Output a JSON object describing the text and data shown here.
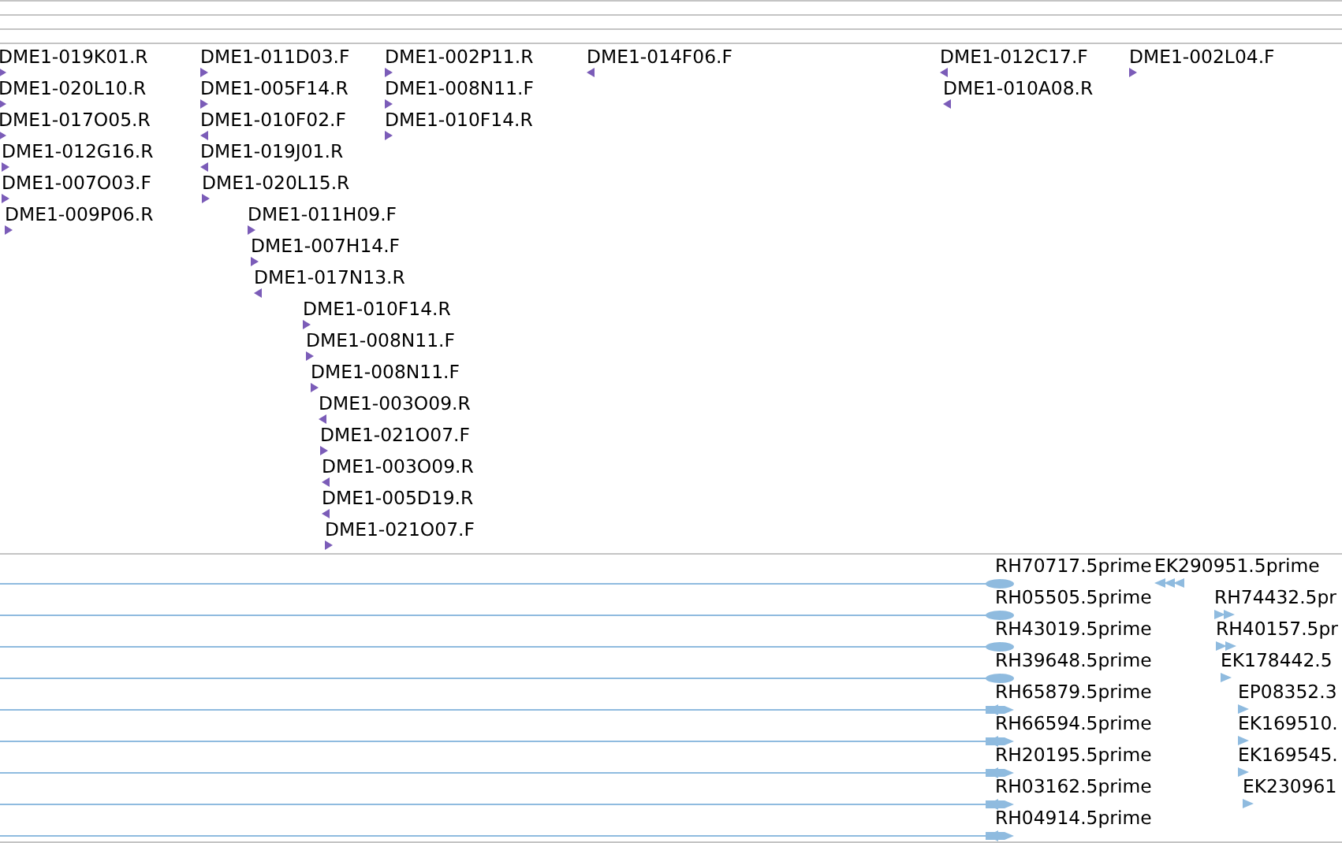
{
  "clone_track": {
    "features": [
      {
        "label": "DME1-019K01.R",
        "reverse": false
      },
      {
        "label": "DME1-011D03.F",
        "reverse": false
      },
      {
        "label": "DME1-002P11.R",
        "reverse": false
      },
      {
        "label": "DME1-014F06.F",
        "reverse": true
      },
      {
        "label": "DME1-012C17.F",
        "reverse": true
      },
      {
        "label": "DME1-002L04.F",
        "reverse": false
      },
      {
        "label": "DME1-020L10.R",
        "reverse": false
      },
      {
        "label": "DME1-005F14.R",
        "reverse": false
      },
      {
        "label": "DME1-008N11.F",
        "reverse": false
      },
      {
        "label": "DME1-010A08.R",
        "reverse": true
      },
      {
        "label": "DME1-017O05.R",
        "reverse": false
      },
      {
        "label": "DME1-010F02.F",
        "reverse": true
      },
      {
        "label": "DME1-010F14.R",
        "reverse": false
      },
      {
        "label": "DME1-012G16.R",
        "reverse": false
      },
      {
        "label": "DME1-019J01.R",
        "reverse": true
      },
      {
        "label": "DME1-007O03.F",
        "reverse": false
      },
      {
        "label": "DME1-020L15.R",
        "reverse": false
      },
      {
        "label": "DME1-009P06.R",
        "reverse": false
      },
      {
        "label": "DME1-011H09.F",
        "reverse": false
      },
      {
        "label": "DME1-007H14.F",
        "reverse": false
      },
      {
        "label": "DME1-017N13.R",
        "reverse": true
      },
      {
        "label": "DME1-010F14.R",
        "reverse": false
      },
      {
        "label": "DME1-008N11.F",
        "reverse": false
      },
      {
        "label": "DME1-008N11.F",
        "reverse": false
      },
      {
        "label": "DME1-003O09.R",
        "reverse": true
      },
      {
        "label": "DME1-021O07.F",
        "reverse": false
      },
      {
        "label": "DME1-003O09.R",
        "reverse": true
      },
      {
        "label": "DME1-005D19.R",
        "reverse": true
      },
      {
        "label": "DME1-021O07.F",
        "reverse": false
      }
    ]
  },
  "est_track": {
    "features": [
      {
        "label": "RH70717.5prime",
        "kind": "oval"
      },
      {
        "label": "EK290951.5prime",
        "kind": "short",
        "reverse": true
      },
      {
        "label": "RH05505.5prime",
        "kind": "oval"
      },
      {
        "label": "RH74432.5pr",
        "kind": "short",
        "reverse": false
      },
      {
        "label": "RH43019.5prime",
        "kind": "oval"
      },
      {
        "label": "RH40157.5pr",
        "kind": "short",
        "reverse": false
      },
      {
        "label": "RH39648.5prime",
        "kind": "oval"
      },
      {
        "label": "EK178442.5",
        "kind": "short",
        "reverse": false
      },
      {
        "label": "RH65879.5prime",
        "kind": "spanning",
        "reverse": false
      },
      {
        "label": "EP08352.3",
        "kind": "short",
        "reverse": false
      },
      {
        "label": "RH66594.5prime",
        "kind": "spanning",
        "reverse": false
      },
      {
        "label": "EK169510.",
        "kind": "short",
        "reverse": false
      },
      {
        "label": "RH20195.5prime",
        "kind": "spanning",
        "reverse": false
      },
      {
        "label": "EK169545.",
        "kind": "short",
        "reverse": false
      },
      {
        "label": "RH03162.5prime",
        "kind": "spanning",
        "reverse": false
      },
      {
        "label": "EK230961",
        "kind": "short",
        "reverse": false
      },
      {
        "label": "RH04914.5prime",
        "kind": "spanning",
        "reverse": false
      }
    ]
  }
}
